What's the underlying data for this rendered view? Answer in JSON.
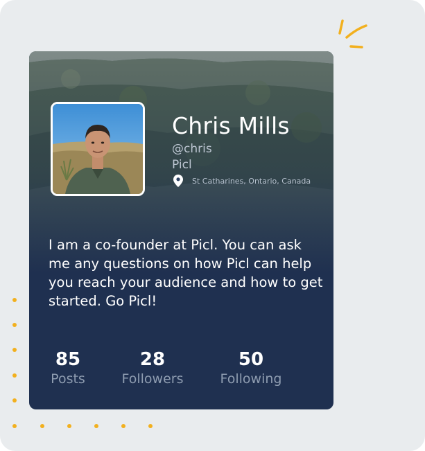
{
  "profile": {
    "name": "Chris Mills",
    "handle": "@chris",
    "company": "Picl",
    "location": "St Catharines, Ontario, Canada",
    "bio": "I am a co-founder at Picl. You can ask me any questions on how Picl can help you reach your audience and how to get started. Go Picl!"
  },
  "stats": [
    {
      "value": "85",
      "label": "Posts"
    },
    {
      "value": "28",
      "label": "Followers"
    },
    {
      "value": "50",
      "label": "Following"
    }
  ],
  "icons": {
    "location": "map-pin-icon"
  },
  "colors": {
    "card": "#1f3050",
    "accent_dots": "#f2b01e",
    "background": "#e9ecee"
  }
}
